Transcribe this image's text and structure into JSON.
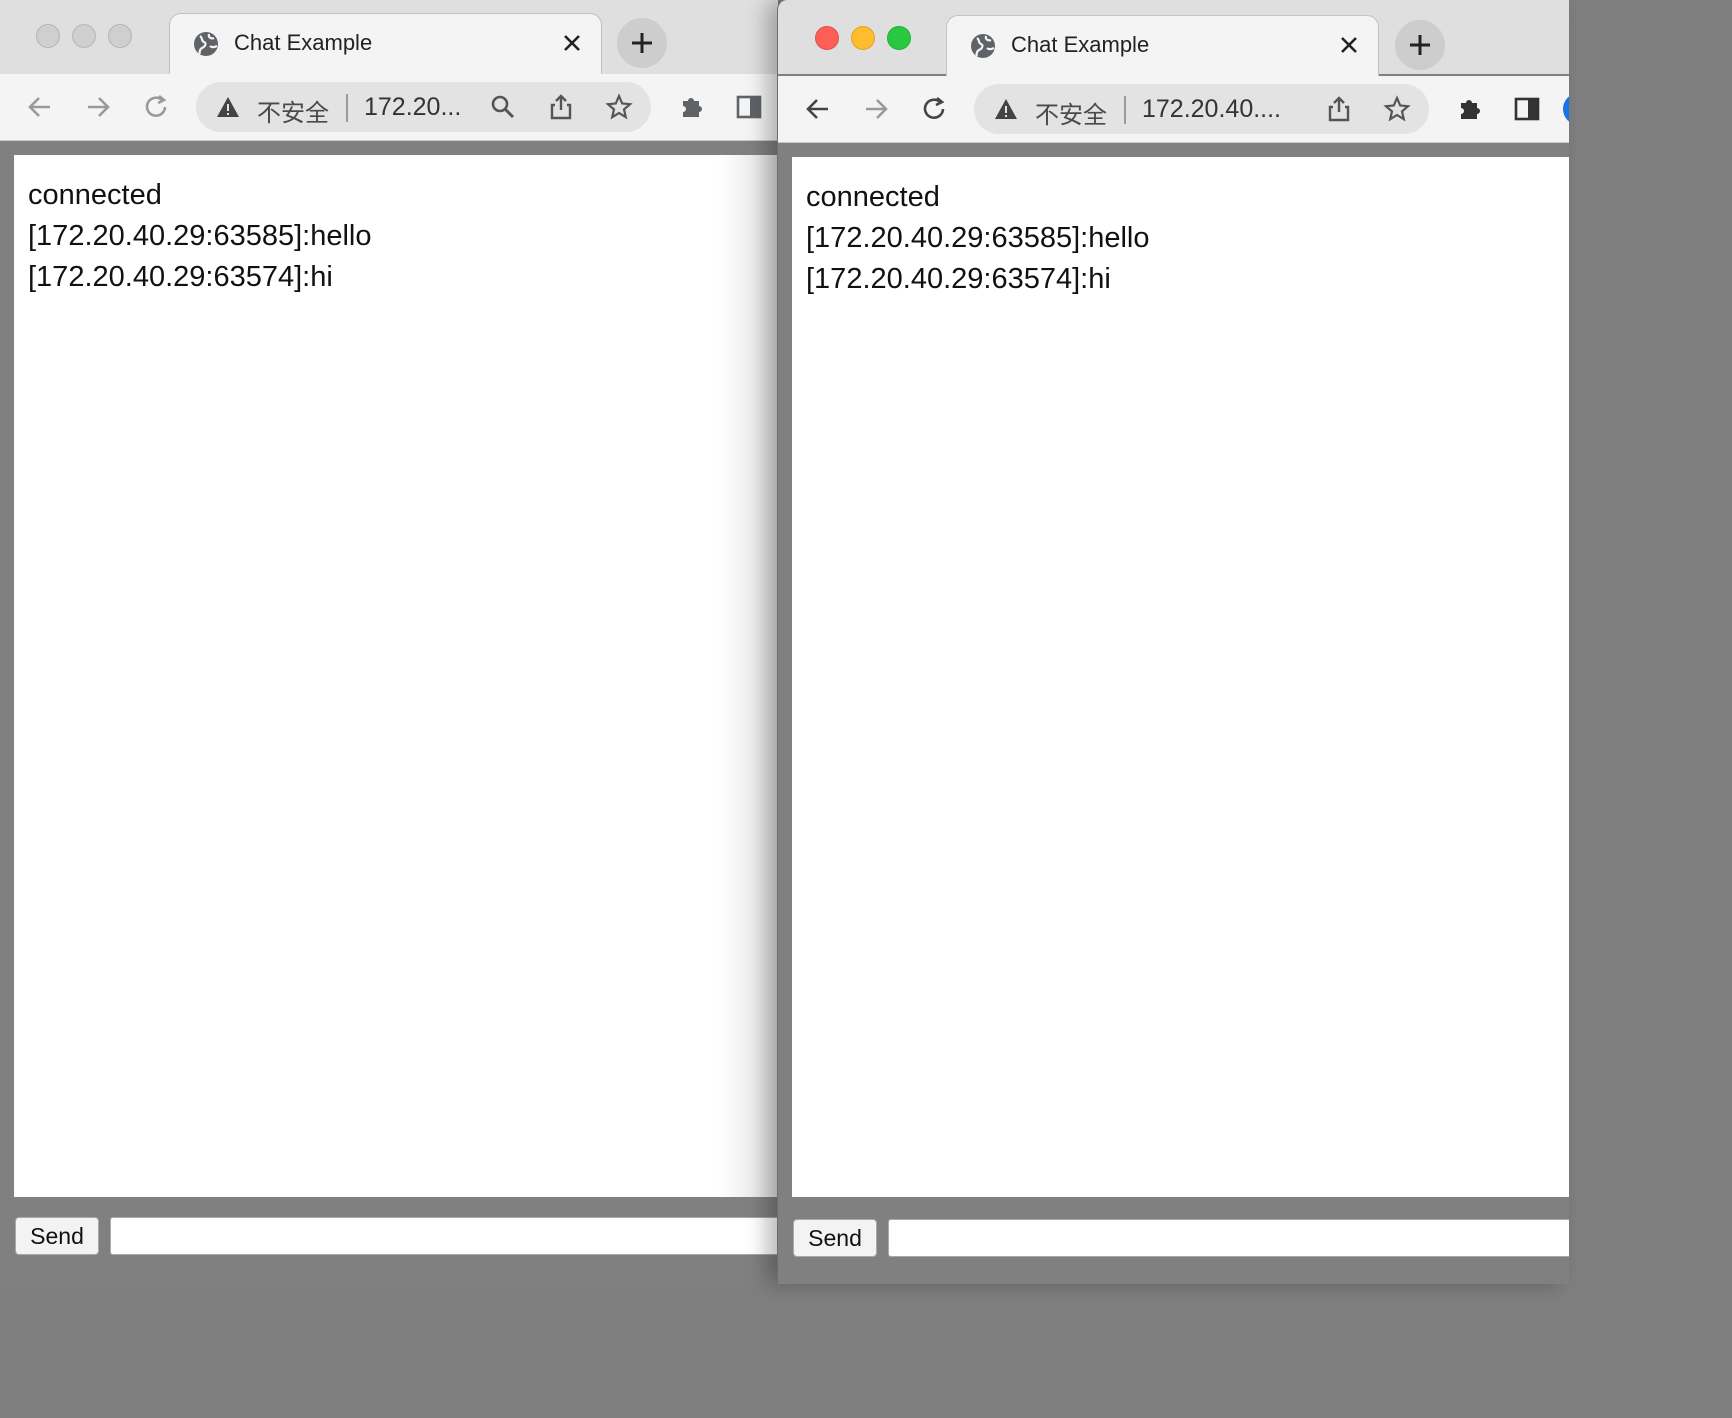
{
  "windows": [
    {
      "tab_title": "Chat Example",
      "security_label": "不安全",
      "url": "172.20...",
      "messages": [
        "connected",
        "[172.20.40.29:63585]:hello",
        "[172.20.40.29:63574]:hi"
      ],
      "send_label": "Send",
      "input_value": ""
    },
    {
      "tab_title": "Chat Example",
      "security_label": "不安全",
      "url": "172.20.40....",
      "messages": [
        "connected",
        "[172.20.40.29:63585]:hello",
        "[172.20.40.29:63574]:hi"
      ],
      "send_label": "Send",
      "input_value": ""
    }
  ]
}
